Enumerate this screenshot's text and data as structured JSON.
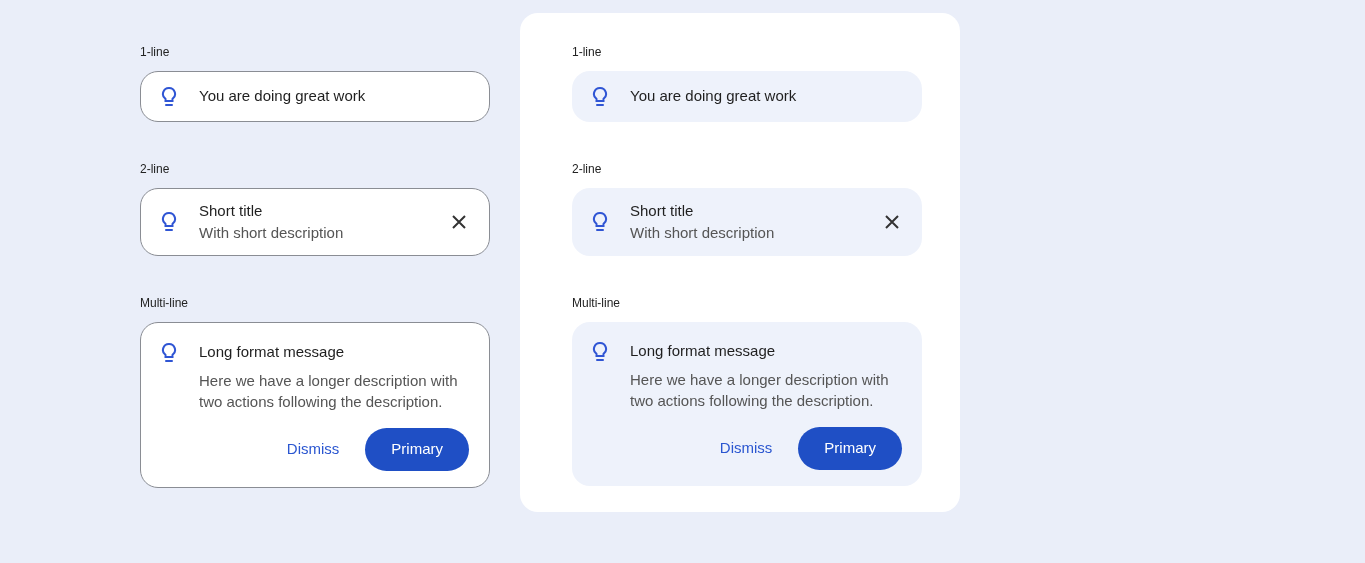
{
  "variants": [
    {
      "kind": "outlined",
      "sections": [
        {
          "label": "1-line",
          "banner": {
            "title": "You are doing great work"
          }
        },
        {
          "label": "2-line",
          "banner": {
            "title": "Short title",
            "description": "With short description",
            "closable": true
          }
        },
        {
          "label": "Multi-line",
          "banner": {
            "title": "Long format message",
            "description": "Here we have a longer description with two actions following the description.",
            "actions": [
              "Dismiss",
              "Primary"
            ]
          }
        }
      ]
    },
    {
      "kind": "filled",
      "sections": [
        {
          "label": "1-line",
          "banner": {
            "title": "You are doing great work"
          }
        },
        {
          "label": "2-line",
          "banner": {
            "title": "Short title",
            "description": "With short description",
            "closable": true
          }
        },
        {
          "label": "Multi-line",
          "banner": {
            "title": "Long format message",
            "description": "Here we have a longer description with two actions following the description.",
            "actions": [
              "Dismiss",
              "Primary"
            ]
          }
        }
      ]
    }
  ]
}
